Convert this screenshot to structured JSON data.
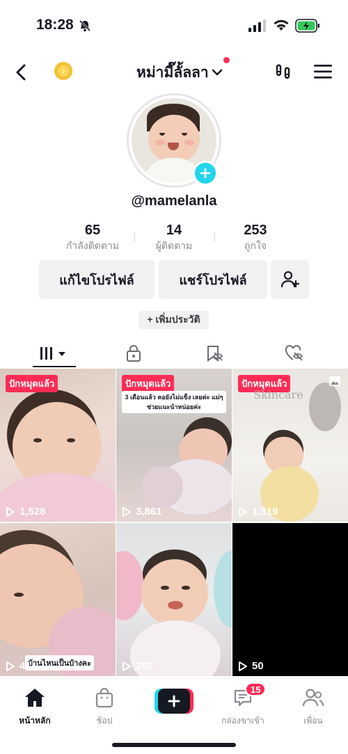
{
  "status_bar": {
    "time": "18:28"
  },
  "header": {
    "username": "หม่ามี๊ลั้ลลา"
  },
  "profile": {
    "handle": "@mamelanla"
  },
  "stats": [
    {
      "value": "65",
      "label": "กำลังติดตาม"
    },
    {
      "value": "14",
      "label": "ผู้ติดตาม"
    },
    {
      "value": "253",
      "label": "ถูกใจ"
    }
  ],
  "actions": {
    "edit_profile": "แก้ไขโปรไฟล์",
    "share_profile": "แชร์โปรไฟล์",
    "add_bio": "+ เพิ่มประวัติ"
  },
  "tabs": [
    {
      "icon": "grid-icon",
      "active": true
    },
    {
      "icon": "lock-icon"
    },
    {
      "icon": "bookmark-icon"
    },
    {
      "icon": "liked-icon"
    }
  ],
  "videos": [
    {
      "pinned_label": "ปักหมุดแล้ว",
      "views": "1,528",
      "caption": ""
    },
    {
      "pinned_label": "ปักหมุดแล้ว",
      "views": "3,861",
      "caption": "3 เดือนแล้ว คอยังไม่แข็ง เลยค่ะ แม่ๆช่วยแนะนำหน่อยค่ะ"
    },
    {
      "pinned_label": "ปักหมุดแล้ว",
      "views": "1,519",
      "caption": "Skincare",
      "photo": true
    },
    {
      "views": "41",
      "caption": "บ้านไหนเป็นบ้างคะ"
    },
    {
      "views": "282",
      "caption": ""
    },
    {
      "views": "50",
      "caption": ""
    }
  ],
  "bottom_nav": {
    "home": "หน้าหลัก",
    "shop": "ช้อป",
    "inbox": "กล่องขาเข้า",
    "inbox_badge": "15",
    "friends": "เพื่อน"
  },
  "colors": {
    "accent_red": "#fe2c55",
    "accent_cyan": "#20d5ec",
    "text": "#161823"
  }
}
